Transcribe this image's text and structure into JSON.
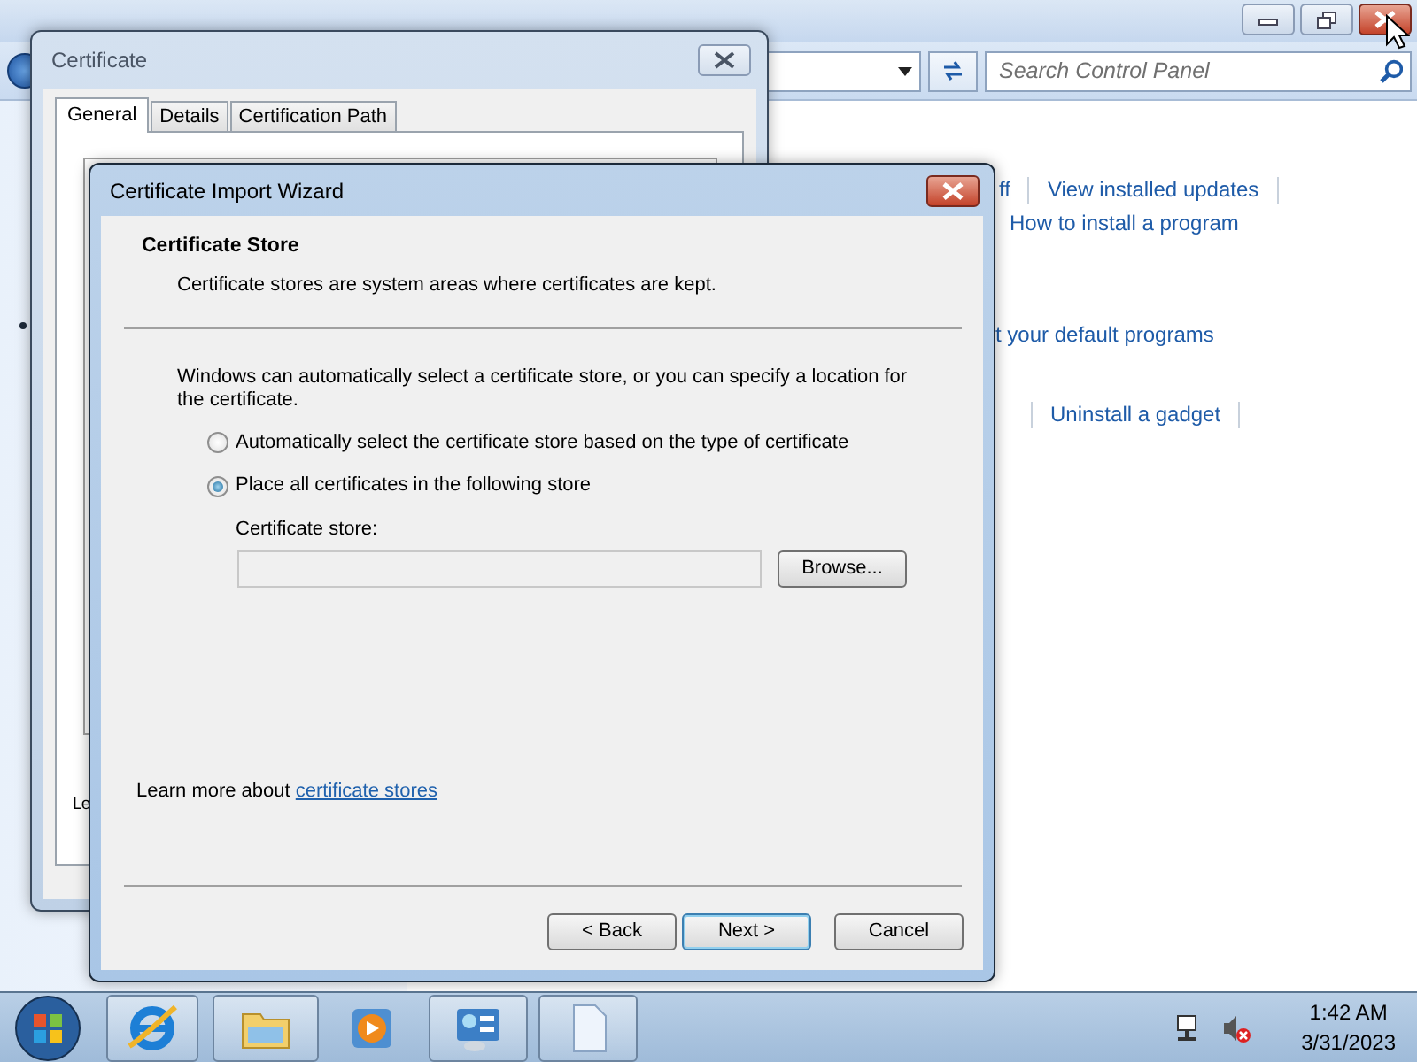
{
  "control_panel": {
    "search": {
      "placeholder": "Search Control Panel"
    },
    "link_rows": [
      {
        "links": [
          "ff",
          "View installed updates"
        ]
      },
      {
        "links": [
          "How to install a program"
        ]
      },
      {
        "links": [
          "t your default programs"
        ]
      },
      {
        "links": [
          "Uninstall a gadget"
        ]
      }
    ]
  },
  "certificate_dialog": {
    "title": "Certificate",
    "tabs": [
      {
        "label": "General",
        "selected": true
      },
      {
        "label": "Details",
        "selected": false
      },
      {
        "label": "Certification Path",
        "selected": false
      }
    ],
    "cut_text": "Le"
  },
  "wizard": {
    "title": "Certificate Import Wizard",
    "heading": "Certificate Store",
    "subheading": "Certificate stores are system areas where certificates are kept.",
    "intro": "Windows can automatically select a certificate store, or you can specify a location for the certificate.",
    "options": [
      {
        "label": "Automatically select the certificate store based on the type of certificate",
        "selected": false
      },
      {
        "label": "Place all certificates in the following store",
        "selected": true
      }
    ],
    "store_label": "Certificate store:",
    "store_field": {
      "disabled": true
    },
    "browse_button": "Browse...",
    "learn_more": {
      "text": "Learn more about",
      "link": "certificate stores"
    },
    "buttons": [
      {
        "label": "< Back",
        "default": false
      },
      {
        "label": "Next >",
        "default": true
      },
      {
        "label": "Cancel",
        "default": false
      }
    ]
  },
  "taskbar": {
    "apps": [
      {
        "kind": "browser",
        "running": true
      },
      {
        "kind": "folder",
        "running": true
      },
      {
        "kind": "media",
        "running": false
      },
      {
        "kind": "control-panel",
        "running": true
      },
      {
        "kind": "document",
        "running": true
      }
    ],
    "clock": {
      "time": "1:42 AM",
      "date": "3/31/2023"
    }
  }
}
